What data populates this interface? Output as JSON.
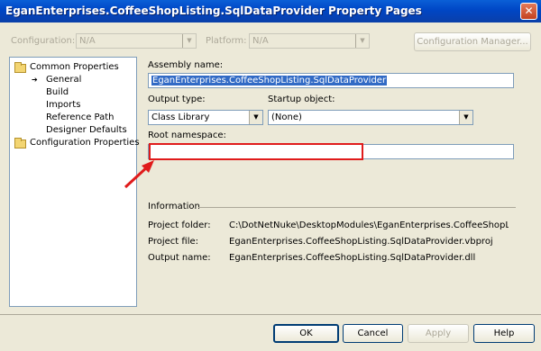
{
  "window": {
    "title": "EganEnterprises.CoffeeShopListing.SqlDataProvider Property Pages",
    "close_glyph": "✕"
  },
  "toolbar": {
    "configuration_label": "Configuration:",
    "configuration_value": "N/A",
    "platform_label": "Platform:",
    "platform_value": "N/A",
    "config_manager_label": "Configuration Manager..."
  },
  "tree": {
    "items": [
      {
        "label": "Common Properties",
        "icon": "folder-icon"
      },
      {
        "label": "General",
        "icon": "arrow-icon",
        "selected": true
      },
      {
        "label": "Build"
      },
      {
        "label": "Imports"
      },
      {
        "label": "Reference Path"
      },
      {
        "label": "Designer Defaults"
      },
      {
        "label": "Configuration Properties",
        "icon": "folder-icon"
      }
    ]
  },
  "general": {
    "assembly_name_label": "Assembly name:",
    "assembly_name_value": "EganEnterprises.CoffeeShopListing.SqlDataProvider",
    "output_type_label": "Output type:",
    "output_type_value": "Class Library",
    "startup_object_label": "Startup object:",
    "startup_object_value": "(None)",
    "root_namespace_label": "Root namespace:",
    "root_namespace_value": ""
  },
  "information": {
    "heading": "Information",
    "project_folder_label": "Project folder:",
    "project_folder_value": "C:\\DotNetNuke\\DesktopModules\\EganEnterprises.CoffeeShopListing\\F",
    "project_file_label": "Project file:",
    "project_file_value": "EganEnterprises.CoffeeShopListing.SqlDataProvider.vbproj",
    "output_name_label": "Output name:",
    "output_name_value": "EganEnterprises.CoffeeShopListing.SqlDataProvider.dll"
  },
  "buttons": {
    "ok": "OK",
    "cancel": "Cancel",
    "apply": "Apply",
    "help": "Help"
  },
  "colors": {
    "annotation_red": "#e01b1b",
    "title_blue": "#0046c5"
  }
}
